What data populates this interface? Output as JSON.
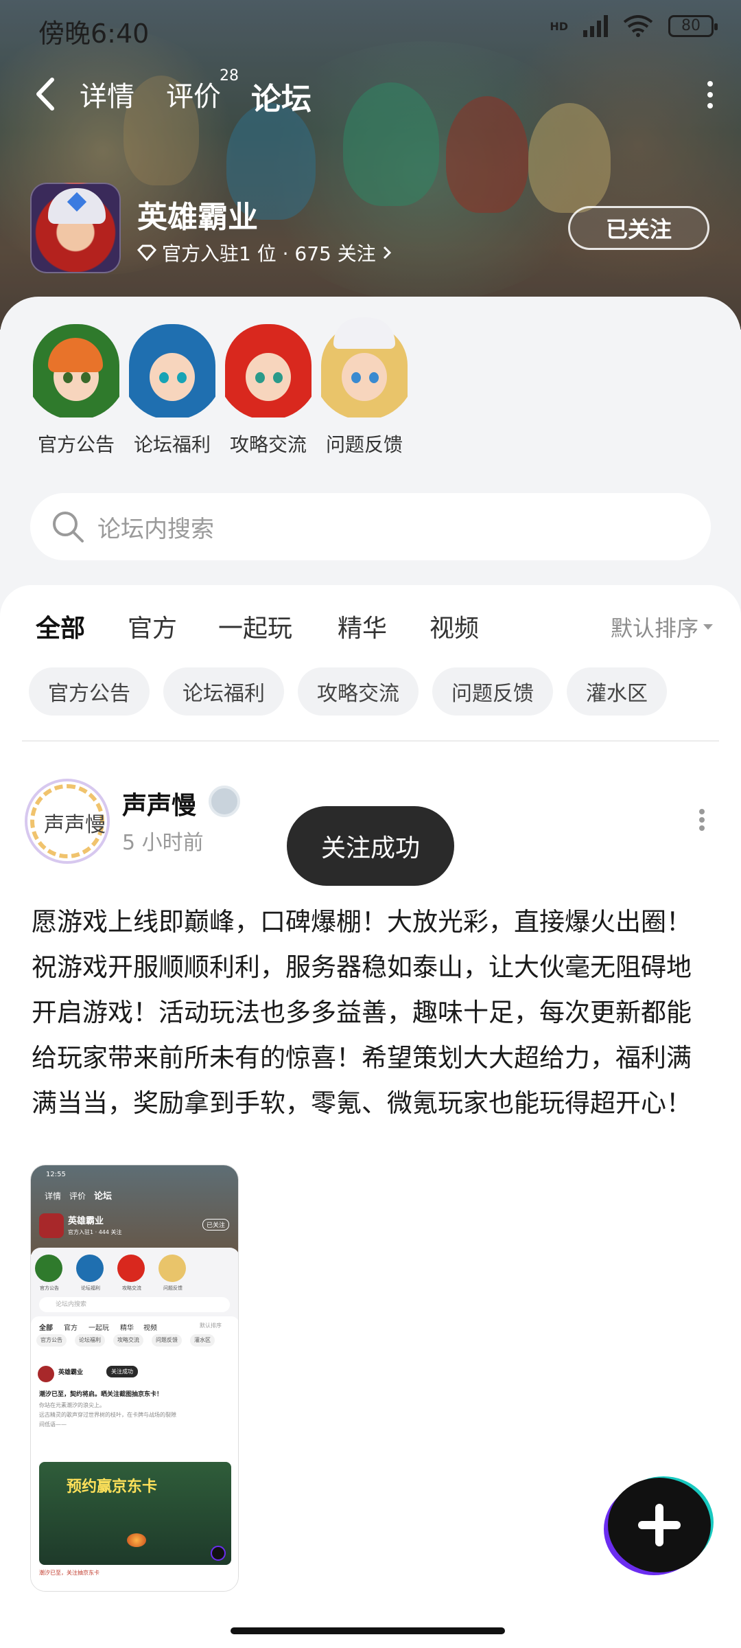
{
  "status_bar": {
    "time": "傍晚6:40",
    "network": "HD",
    "battery": "80"
  },
  "nav": {
    "tabs": [
      {
        "label": "详情"
      },
      {
        "label": "评价",
        "count": "28"
      },
      {
        "label": "论坛"
      }
    ],
    "active_tab": "论坛"
  },
  "game": {
    "name": "英雄霸业",
    "subtitle": "官方入驻1 位 · 675 关注",
    "follow_button": "已关注"
  },
  "categories": [
    {
      "label": "官方公告"
    },
    {
      "label": "论坛福利"
    },
    {
      "label": "攻略交流"
    },
    {
      "label": "问题反馈"
    }
  ],
  "search": {
    "placeholder": "论坛内搜索"
  },
  "feed_tabs": {
    "items": [
      "全部",
      "官方",
      "一起玩",
      "精华",
      "视频"
    ],
    "active": "全部",
    "sort": "默认排序"
  },
  "chips": [
    "官方公告",
    "论坛福利",
    "攻略交流",
    "问题反馈",
    "灌水区"
  ],
  "post": {
    "author": "声声慢",
    "avatar_text": "声声慢",
    "time": "5 小时前",
    "toast": "关注成功",
    "text": "愿游戏上线即巅峰，口碑爆棚！大放光彩，直接爆火出圈！祝游戏开服顺顺利利，服务器稳如泰山，让大伙毫无阻碍地开启游戏！活动玩法也多多益善，趣味十足，每次更新都能给玩家带来前所未有的惊喜！希望策划大大超给力，福利满满当当，奖励拿到手软，零氪、微氪玩家也能玩得超开心！",
    "image": {
      "status_time": "12:55",
      "tabs": [
        "详情",
        "评价",
        "论坛"
      ],
      "game_name": "英雄霸业",
      "follow": "已关注",
      "sub": "官方入驻1 · 444 关注",
      "cats": [
        "官方公告",
        "论坛福利",
        "攻略交流",
        "问题反馈"
      ],
      "search": "论坛内搜索",
      "feed_tabs": [
        "全部",
        "官方",
        "一起玩",
        "精华",
        "视频"
      ],
      "sort": "默认排序",
      "chips": [
        "官方公告",
        "论坛福利",
        "攻略交流",
        "问题反馈",
        "灌水区"
      ],
      "post_author": "英雄霸业",
      "toast": "关注成功",
      "post_title": "潮汐已至，契约将启。晒关注截图抽京东卡！",
      "post_line1": "你站在元素潮汐的浪尖上。",
      "post_line2": "远古精灵的歌声穿过世界树的枝叶，在卡牌与战场的裂隙",
      "post_line3": "间低语——",
      "banner_text": "预约赢京东卡",
      "footer_text": "潮汐已至，关注抽京东卡"
    }
  },
  "colors": {
    "accent": "#20d1c0",
    "fab": "#111111",
    "fab_ring_1": "#6b2df0",
    "fab_ring_2": "#18c9c0"
  },
  "icons": [
    "back-arrow-icon",
    "more-vertical-icon",
    "diamond-icon",
    "chevron-right-icon",
    "search-icon",
    "caret-down-icon",
    "plus-icon"
  ]
}
